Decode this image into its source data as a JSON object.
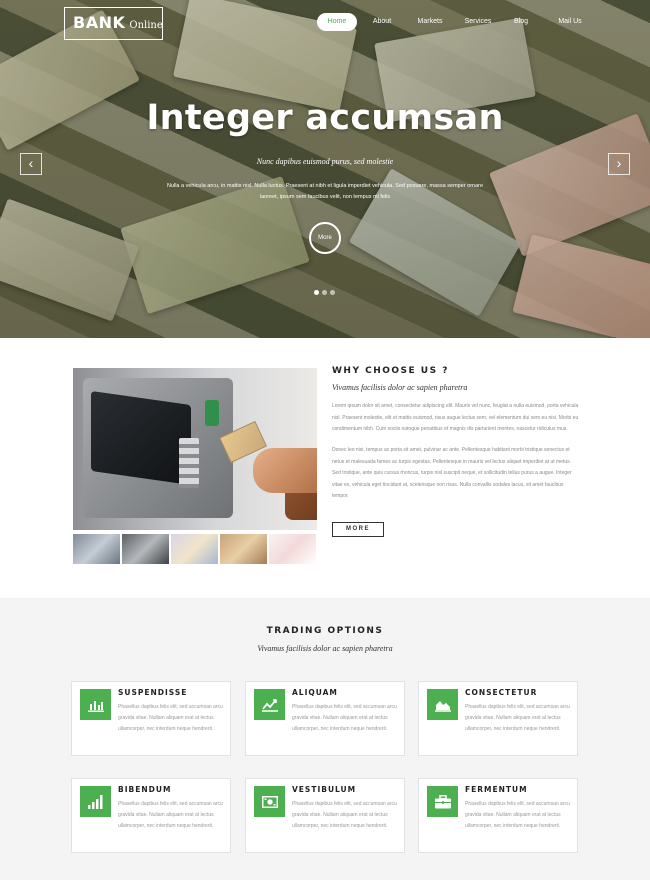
{
  "brand": {
    "name": "BANK",
    "tagline": "Online"
  },
  "nav": {
    "items": [
      {
        "label": "Home",
        "active": true
      },
      {
        "label": "About"
      },
      {
        "label": "Markets"
      },
      {
        "label": "Services"
      },
      {
        "label": "Blog"
      },
      {
        "label": "Mail Us"
      }
    ]
  },
  "hero": {
    "title": "Integer accumsan",
    "subtitle": "Nunc dapibus euismod purus, sed molestie",
    "text": "Nulla a vehicula arcu, in mattis nisl. Nulla luctus. Praesent at nibh et ligula imperdiet vehicula. Sed posuere, massa semper ornare laoreet, ipsum sem faucibus velit, non tempus mi felis",
    "more_label": "More",
    "prev_arrow": "‹",
    "next_arrow": "›",
    "slide_count": 3,
    "active_slide": 1
  },
  "why": {
    "title": "WHY CHOOSE US ?",
    "subtitle": "Vivamus facilisis dolor ac sapien pharetra",
    "p1": "Lorem ipsum dolor sit amet, consectetur adipiscing elit. Mauris vel nunc, feugiat a nulla euismod, porta vehicula nisl. Praesent molestie, elit et mattis euismod, risus augue lectus sem, vel elementum dui sem eu nisi. Morbi eu condimentum nibh. Cum sociis natoque penatibus et magnis dis parturient montes, nascetur ridiculus mus.",
    "p2": "Donec leo nisi, tempus ac porta sit amet, pulvinar ac ante. Pellentesque habitant morbi tristique senectus et netus et malesuada fames ac turpis egestas. Pellentesque in mauris vel lectus aliquet imperdiet at ut metus. Sed tristique, ante quis cursus rhoncus, turpis nisl suscipit neque, et sollicitudin tellus purus a augue. Integer vitae ex, vehicula eget tincidunt at, scelerisque non risus. Nulla convallis sodales lacus, sit amet faucibus tempor.",
    "more_label": "MORE"
  },
  "trading": {
    "title": "TRADING OPTIONS",
    "subtitle": "Vivamus facilisis dolor ac sapien pharetra",
    "accent": "#4caf50",
    "cards": [
      {
        "title": "SUSPENDISSE",
        "icon": "bar-chart-icon",
        "text": "Phasellus dapibus felis elit, sed accumsan arcu gravida vitae. Nullam aliquam erat at lectus ullamcorper, nec interdum neque hendrerit."
      },
      {
        "title": "ALIQUAM",
        "icon": "line-chart-icon",
        "text": "Phasellus dapibus felis elit, sed accumsan arcu gravida vitae. Nullam aliquam erat at lectus ullamcorper, nec interdum neque hendrerit."
      },
      {
        "title": "CONSECTETUR",
        "icon": "area-chart-icon",
        "text": "Phasellus dapibus felis elit, sed accumsan arcu gravida vitae. Nullam aliquam erat at lectus ullamcorper, nec interdum neque hendrerit."
      },
      {
        "title": "BIBENDUM",
        "icon": "signal-icon",
        "text": "Phasellus dapibus felis elit, sed accumsan arcu gravida vitae. Nullam aliquam erat at lectus ullamcorper, nec interdum neque hendrerit."
      },
      {
        "title": "VESTIBULUM",
        "icon": "money-icon",
        "text": "Phasellus dapibus felis elit, sed accumsan arcu gravida vitae. Nullam aliquam erat at lectus ullamcorper, nec interdum neque hendrerit."
      },
      {
        "title": "FERMENTUM",
        "icon": "briefcase-icon",
        "text": "Phasellus dapibus felis elit, sed accumsan arcu gravida vitae. Nullam aliquam erat at lectus ullamcorper, nec interdum neque hendrerit."
      }
    ]
  }
}
